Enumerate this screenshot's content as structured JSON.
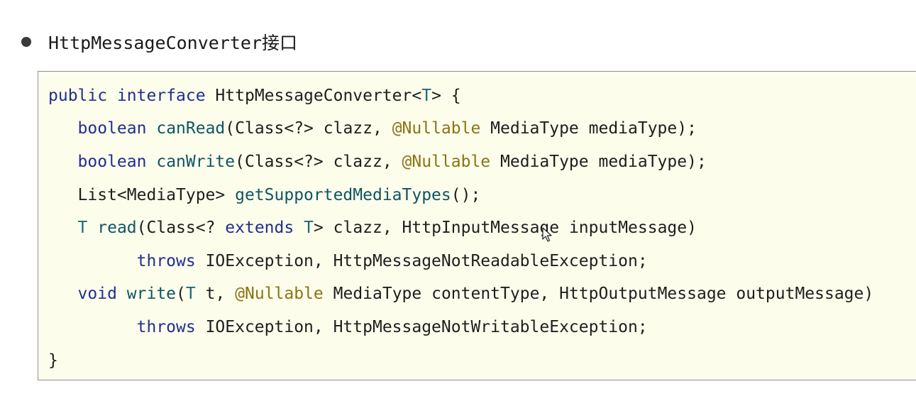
{
  "heading": {
    "text": "HttpMessageConverter接口"
  },
  "code": {
    "lines": [
      [
        {
          "t": "public",
          "c": "kw"
        },
        {
          "t": " ",
          "c": "plain"
        },
        {
          "t": "interface",
          "c": "kw"
        },
        {
          "t": " HttpMessageConverter<",
          "c": "plain"
        },
        {
          "t": "T",
          "c": "type"
        },
        {
          "t": "> {",
          "c": "plain"
        }
      ],
      [
        {
          "t": "   ",
          "c": "plain"
        },
        {
          "t": "boolean",
          "c": "kw"
        },
        {
          "t": " ",
          "c": "plain"
        },
        {
          "t": "canRead",
          "c": "fn"
        },
        {
          "t": "(Class<?> clazz, ",
          "c": "plain"
        },
        {
          "t": "@Nullable",
          "c": "ann"
        },
        {
          "t": " MediaType mediaType);",
          "c": "plain"
        }
      ],
      [
        {
          "t": "   ",
          "c": "plain"
        },
        {
          "t": "boolean",
          "c": "kw"
        },
        {
          "t": " ",
          "c": "plain"
        },
        {
          "t": "canWrite",
          "c": "fn"
        },
        {
          "t": "(Class<?> clazz, ",
          "c": "plain"
        },
        {
          "t": "@Nullable",
          "c": "ann"
        },
        {
          "t": " MediaType mediaType);",
          "c": "plain"
        }
      ],
      [
        {
          "t": "   List<MediaType> ",
          "c": "plain"
        },
        {
          "t": "getSupportedMediaTypes",
          "c": "fn"
        },
        {
          "t": "();",
          "c": "plain"
        }
      ],
      [
        {
          "t": "   ",
          "c": "plain"
        },
        {
          "t": "T",
          "c": "type"
        },
        {
          "t": " ",
          "c": "plain"
        },
        {
          "t": "read",
          "c": "fn"
        },
        {
          "t": "(Class<? ",
          "c": "plain"
        },
        {
          "t": "extends",
          "c": "kw"
        },
        {
          "t": " ",
          "c": "plain"
        },
        {
          "t": "T",
          "c": "type"
        },
        {
          "t": "> clazz, HttpInputMessage inputMessage)",
          "c": "plain"
        }
      ],
      [
        {
          "t": "         ",
          "c": "plain"
        },
        {
          "t": "throws",
          "c": "kw"
        },
        {
          "t": " IOException, HttpMessageNotReadableException;",
          "c": "plain"
        }
      ],
      [
        {
          "t": "   ",
          "c": "plain"
        },
        {
          "t": "void",
          "c": "kw"
        },
        {
          "t": " ",
          "c": "plain"
        },
        {
          "t": "write",
          "c": "fn"
        },
        {
          "t": "(",
          "c": "plain"
        },
        {
          "t": "T",
          "c": "type"
        },
        {
          "t": " t, ",
          "c": "plain"
        },
        {
          "t": "@Nullable",
          "c": "ann"
        },
        {
          "t": " MediaType contentType, HttpOutputMessage outputMessage)",
          "c": "plain"
        }
      ],
      [
        {
          "t": "         ",
          "c": "plain"
        },
        {
          "t": "throws",
          "c": "kw"
        },
        {
          "t": " IOException, HttpMessageNotWritableException;",
          "c": "plain"
        }
      ],
      [
        {
          "t": "}",
          "c": "plain"
        }
      ]
    ]
  }
}
